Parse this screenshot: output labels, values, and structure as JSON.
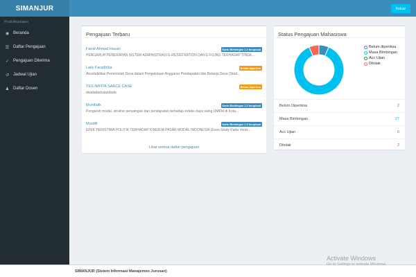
{
  "app": {
    "title": "SIMANJUR"
  },
  "user_panel": {
    "label": "Prodi Akuntansi"
  },
  "sidebar": {
    "items": [
      {
        "label": "Beranda",
        "icon": "dashboard-icon"
      },
      {
        "label": "Daftar Pengajuan",
        "icon": "list-icon"
      },
      {
        "label": "Pengajuan Diterima",
        "icon": "thumbs-up-icon"
      },
      {
        "label": "Jadwal Ujian",
        "icon": "history-icon"
      },
      {
        "label": "Daftar Dosen",
        "icon": "user-icon"
      }
    ]
  },
  "topbar": {
    "logout_label": "Keluar"
  },
  "recent": {
    "title": "Pengajuan Terbaru",
    "items": [
      {
        "name": "Fandi Ahmad Hasan",
        "desc": "PENGARUH PENERAPAN SISTEM ADMINISTRASI E-RESISTRATION DAN E-FILING TERHADAP TINGK...",
        "status": "Kartu Bimbingan 1-3 terupload",
        "status_color": "#3c8dbc"
      },
      {
        "name": "Laily Faradhiba",
        "desc": "Akuntabilitas Pemerintah Desa dalam Pengelolaan Anggaran Pendapatan dan Belanja Desa (Stud...",
        "status": "Belum diperiksa",
        "status_color": "#f39c12"
      },
      {
        "name": "TES IMFITA SARCE CASE",
        "desc": "dsadadadsaasdada",
        "status": "Belum diperiksa",
        "status_color": "#f39c12"
      },
      {
        "name": "Munifatik",
        "desc": "Pengaruh modal, struktur persaingan dan pendapatan terhadap indeks daya saing UMKM di Kota...",
        "status": "Kartu Bimbingan 1-3 terupload",
        "status_color": "#3c8dbc"
      },
      {
        "name": "Murdifi",
        "desc": "EFEK PERISTIWA POLITIK TERHADAP KINERJA PASAR MODAL INDONESIA (Even Study Pada Vonis ...",
        "status": "Kartu Bimbingan 1-3 terupload",
        "status_color": "#3c8dbc"
      }
    ],
    "see_all": "Lihat semua daftar pengajuan"
  },
  "status": {
    "title": "Status Pengajuan Mahasiswa",
    "legend": [
      {
        "label": "Belum diperiksa",
        "color": "#3c8dbc"
      },
      {
        "label": "Masa Bimbingan",
        "color": "#00c0ef"
      },
      {
        "label": "Acc Ujian",
        "color": "#00a65a"
      },
      {
        "label": "Ditolak",
        "color": "#f56954"
      }
    ],
    "rows": [
      {
        "label": "Belum Diperiksa",
        "value": "2",
        "color": "#3c8dbc"
      },
      {
        "label": "Masa Bimbingan",
        "value": "27",
        "color": "#00c0ef"
      },
      {
        "label": "Acc Ujian",
        "value": "0",
        "color": "#00a65a"
      },
      {
        "label": "Ditolak",
        "value": "2",
        "color": "#dd4b39"
      }
    ]
  },
  "footer": {
    "brand": "SIMANJUR",
    "subtitle": "(Sistem Informasi Manajemen Jurusan)"
  },
  "watermark": {
    "line1": "Activate Windows",
    "line2": "Go to Settings to activate Windows."
  }
}
